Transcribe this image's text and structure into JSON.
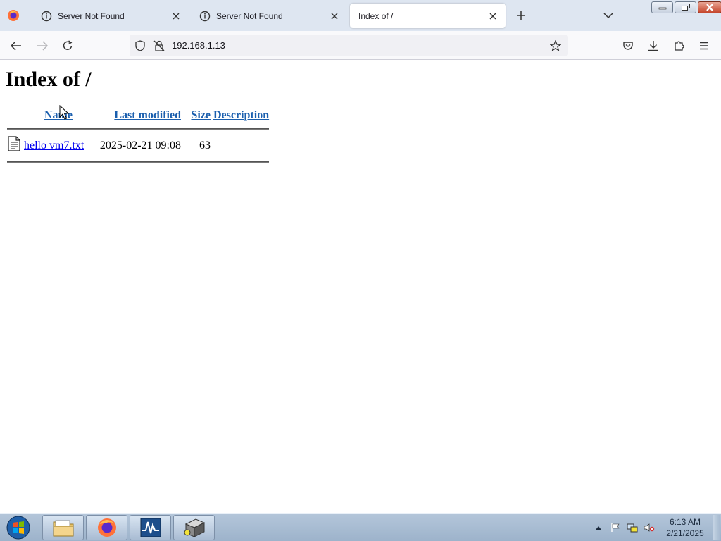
{
  "browser": {
    "tabs": [
      {
        "title": "Server Not Found",
        "active": false,
        "icon": "info-icon"
      },
      {
        "title": "Server Not Found",
        "active": false,
        "icon": "info-icon"
      },
      {
        "title": "Index of /",
        "active": true,
        "icon": ""
      }
    ],
    "url": "192.168.1.13"
  },
  "page": {
    "title": "Index of /",
    "columns": {
      "name": "Name",
      "last_modified": "Last modified",
      "size": "Size",
      "description": "Description"
    },
    "files": [
      {
        "name": "hello vm7.txt",
        "last_modified": "2025-02-21 09:08",
        "size": "63",
        "description": "",
        "icon": "text-file-icon"
      }
    ]
  },
  "taskbar": {
    "apps": [
      "file-explorer-icon",
      "firefox-icon",
      "activity-monitor-icon",
      "disk-tool-icon"
    ],
    "clock": {
      "time": "6:13 AM",
      "date": "2/21/2025"
    }
  },
  "colors": {
    "link": "#0000ee",
    "tabstrip": "#dee6f1",
    "taskbar": "#b4c6da"
  }
}
